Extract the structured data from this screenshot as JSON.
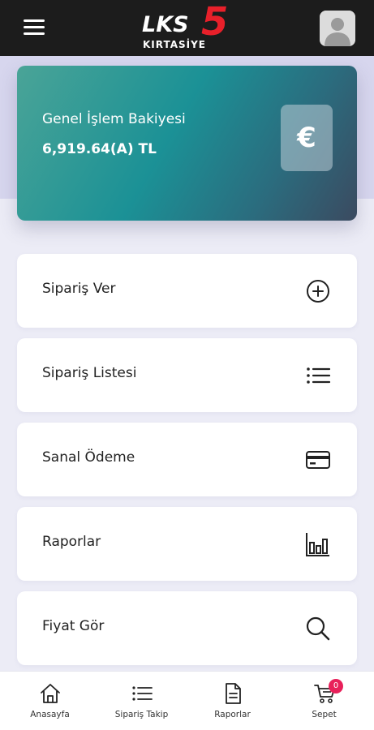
{
  "header": {
    "logo_main": "LKS",
    "logo_number": "5",
    "logo_sub": "KIRTASİYE"
  },
  "balance": {
    "title": "Genel İşlem Bakiyesi",
    "value": "6,919.64(A) TL",
    "currency_symbol": "€"
  },
  "menu": [
    {
      "label": "Sipariş Ver",
      "icon": "plus-circle-icon"
    },
    {
      "label": "Sipariş Listesi",
      "icon": "list-icon"
    },
    {
      "label": "Sanal Ödeme",
      "icon": "credit-card-icon"
    },
    {
      "label": "Raporlar",
      "icon": "bar-chart-icon"
    },
    {
      "label": "Fiyat Gör",
      "icon": "search-icon"
    }
  ],
  "bottom_nav": [
    {
      "label": "Anasayfa",
      "icon": "home-icon"
    },
    {
      "label": "Sipariş Takip",
      "icon": "list-icon"
    },
    {
      "label": "Raporlar",
      "icon": "document-icon"
    },
    {
      "label": "Sepet",
      "icon": "cart-icon"
    }
  ],
  "cart_badge": "0",
  "colors": {
    "header": "#1c1c1c",
    "brand_red": "#e8202a",
    "card_gradient_start": "#4aa497",
    "card_gradient_end": "#3b4a60",
    "badge": "#e8205a"
  }
}
